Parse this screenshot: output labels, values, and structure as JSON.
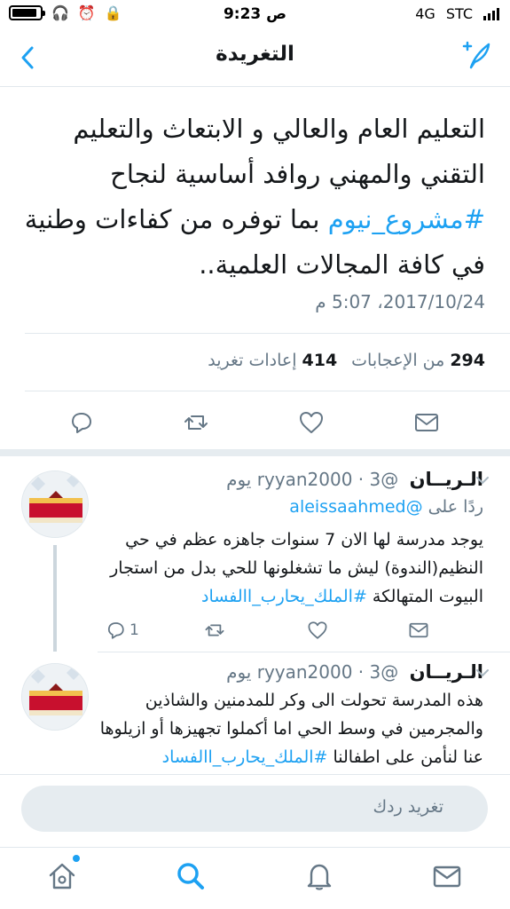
{
  "status_bar": {
    "time": "9:23 ص",
    "carrier": "STC",
    "network": "4G",
    "battery_level": 0.9
  },
  "nav": {
    "title": "التغريدة",
    "back_icon": "chevron-left-icon",
    "compose_icon": "compose-tweet-icon"
  },
  "tweet": {
    "text_before": "التعليم العام والعالي و الابتعاث والتعليم التقني والمهني روافد أساسية لنجاح ",
    "hashtag": "#مشروع_نيوم",
    "text_after": " بما توفره من كفاءات وطنية في كافة المجالات العلمية..",
    "date": "2017/10/24، 5:07 م",
    "likes_count": "294",
    "likes_label": "من الإعجابات",
    "retweets_count": "414",
    "retweets_label": "إعادات تغريد",
    "accent": "#1da1f2"
  },
  "replies": [
    {
      "name": "الـريــان",
      "handle": "@ryyan2000",
      "time": "3 يوم",
      "reply_to_label": "ردًا على",
      "reply_to_handle": "@aleissaahmed",
      "text": "يوجد مدرسة لها الان 7 سنوات جاهزه عظم في حي النظيم(الندوة) ليش ما تشغلونها للحي بدل من استجار البيوت المتهالكة ",
      "hashtag": "#الملك_يحارب_االفساد",
      "reply_count": "1"
    },
    {
      "name": "الـريــان",
      "handle": "@ryyan2000",
      "time": "3 يوم",
      "text": "هذه المدرسة تحولت الى وكر للمدمنين والشاذين والمجرمين في وسط الحي اما أكملوا تجهيزها أو ازيلوها عنا لنأمن على اطفالنا  ",
      "hashtag": "#الملك_يحارب_االفساد"
    }
  ],
  "composer": {
    "placeholder": "تغريد ردك"
  },
  "tabs": [
    "home-icon",
    "search-icon",
    "notifications-icon",
    "messages-icon"
  ]
}
